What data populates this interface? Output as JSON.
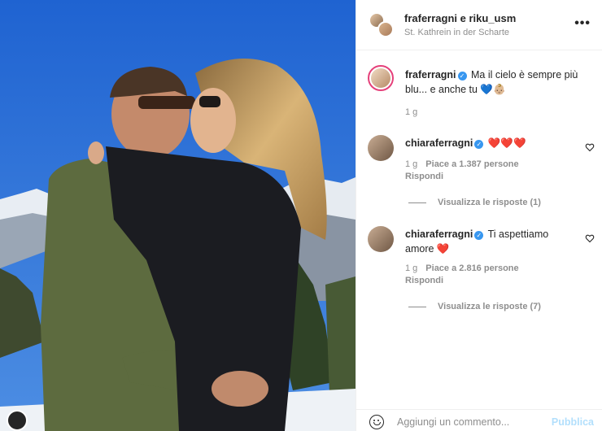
{
  "post": {
    "header": {
      "title": "fraferragni e riku_usm",
      "location": "St. Kathrein in der Scharte",
      "more_icon": "more-horizontal-icon"
    },
    "caption": {
      "username": "fraferragni",
      "verified": true,
      "text": "Ma il cielo è sempre più blu... e anche tu 💙👶🏼",
      "time": "1 g"
    },
    "comments": [
      {
        "username": "chiaraferragni",
        "verified": true,
        "text": "❤️❤️❤️",
        "time": "1 g",
        "likes": "Piace a 1.387 persone",
        "reply_label": "Rispondi",
        "view_replies": "Visualizza le risposte (1)"
      },
      {
        "username": "chiaraferragni",
        "verified": true,
        "text": "Ti aspettiamo amore ❤️",
        "time": "1 g",
        "likes": "Piace a 2.816 persone",
        "reply_label": "Rispondi",
        "view_replies": "Visualizza le risposte (7)"
      }
    ],
    "footer": {
      "placeholder": "Aggiungi un commento...",
      "publish_label": "Pubblica"
    }
  },
  "colors": {
    "verified": "#3897f0",
    "muted_text": "#8e8e8e",
    "publish_disabled": "#b2dffc",
    "story_ring": "#e5407a"
  }
}
